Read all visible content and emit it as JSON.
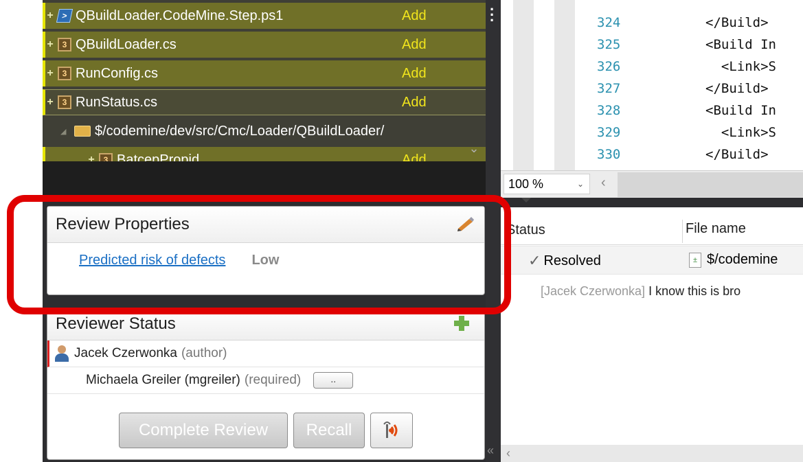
{
  "tree": {
    "items": [
      {
        "name": "QBuildLoader.CodeMine.Step.ps1",
        "status": "Add",
        "icon": "powershell-file-icon"
      },
      {
        "name": "QBuildLoader.cs",
        "status": "Add",
        "icon": "csharp-file-icon"
      },
      {
        "name": "RunConfig.cs",
        "status": "Add",
        "icon": "csharp-file-icon"
      },
      {
        "name": "RunStatus.cs",
        "status": "Add",
        "icon": "csharp-file-icon"
      }
    ],
    "folder": "$/codemine/dev/src/Cmc/Loader/QBuildLoader/",
    "cutoff_item": {
      "name": "BatcepPropid...",
      "status": "Add"
    }
  },
  "review_properties": {
    "title": "Review Properties",
    "risk_label": "Predicted risk of defects",
    "risk_value": "Low"
  },
  "reviewer_status": {
    "title": "Reviewer Status",
    "author_name": "Jacek Czerwonka",
    "author_role": "(author)",
    "reviewer_name": "Michaela Greiler (mgreiler)",
    "reviewer_role": "(required)",
    "more_label": "..",
    "complete_label": "Complete Review",
    "recall_label": "Recall"
  },
  "editor": {
    "lines": [
      {
        "num": "324",
        "code": "</Build>"
      },
      {
        "num": "325",
        "code": "<Build In"
      },
      {
        "num": "326",
        "code": "  <Link>S"
      },
      {
        "num": "327",
        "code": "</Build>"
      },
      {
        "num": "328",
        "code": "<Build In"
      },
      {
        "num": "329",
        "code": "  <Link>S"
      },
      {
        "num": "330",
        "code": "</Build>"
      }
    ],
    "zoom": "100 %"
  },
  "comments": {
    "col_status": "Status",
    "col_file": "File name",
    "thread_status": "Resolved",
    "thread_file": "$/codemine",
    "comment_author": "[Jacek Czerwonka]",
    "comment_text": " I know this is bro"
  },
  "colors": {
    "highlight": "#e00000",
    "added_status": "#f1e51c",
    "link": "#1a6fc4"
  }
}
